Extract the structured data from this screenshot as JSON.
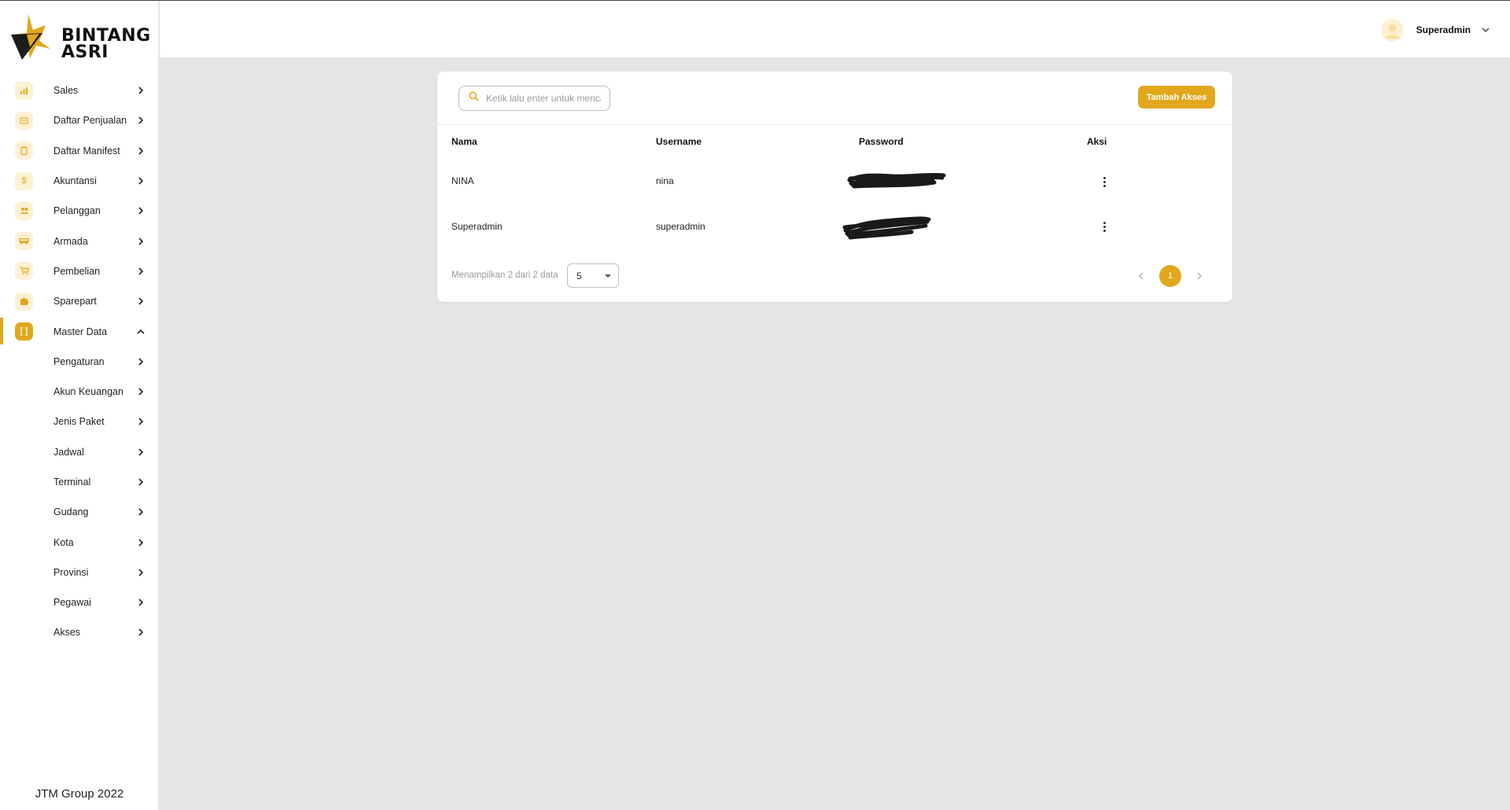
{
  "brand": {
    "line1": "BINTANG",
    "line2": "ASRI",
    "accent": "#e2a71d"
  },
  "sidebar": {
    "items": [
      {
        "label": "Sales",
        "icon": "bar-chart-icon"
      },
      {
        "label": "Daftar Penjualan",
        "icon": "receipt-icon"
      },
      {
        "label": "Daftar Manifest",
        "icon": "clipboard-icon"
      },
      {
        "label": "Akuntansi",
        "icon": "dollar-icon"
      },
      {
        "label": "Pelanggan",
        "icon": "people-icon"
      },
      {
        "label": "Armada",
        "icon": "bus-icon"
      },
      {
        "label": "Pembelian",
        "icon": "cart-icon"
      },
      {
        "label": "Sparepart",
        "icon": "puzzle-icon"
      },
      {
        "label": "Master Data",
        "icon": "brackets-icon"
      }
    ],
    "sub_items": [
      {
        "label": "Pengaturan"
      },
      {
        "label": "Akun Keuangan"
      },
      {
        "label": "Jenis Paket"
      },
      {
        "label": "Jadwal"
      },
      {
        "label": "Terminal"
      },
      {
        "label": "Gudang"
      },
      {
        "label": "Kota"
      },
      {
        "label": "Provinsi"
      },
      {
        "label": "Pegawai"
      },
      {
        "label": "Akses"
      }
    ],
    "footer": "JTM Group 2022"
  },
  "header": {
    "user_name": "Superadmin"
  },
  "toolbar": {
    "search_placeholder": "Ketik lalu enter untuk mencari",
    "add_label": "Tambah Akses"
  },
  "table": {
    "columns": [
      "Nama",
      "Username",
      "Password",
      "Aksi"
    ],
    "rows": [
      {
        "nama": "NINA",
        "username": "nina"
      },
      {
        "nama": "Superadmin",
        "username": "superadmin"
      }
    ]
  },
  "pagination": {
    "showing": "Menampilkan 2 dari 2 data",
    "page_size": "5",
    "current_page": "1"
  }
}
